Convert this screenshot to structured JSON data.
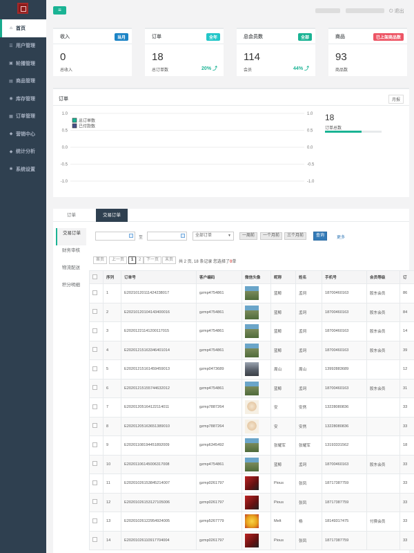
{
  "sidebar": {
    "items": [
      {
        "label": "首页",
        "icon": "home-icon",
        "glyph": "⌂",
        "active": true
      },
      {
        "label": "用户管理",
        "icon": "users-icon",
        "glyph": "☰"
      },
      {
        "label": "轮播管理",
        "icon": "image-icon",
        "glyph": "▣"
      },
      {
        "label": "商品管理",
        "icon": "box-icon",
        "glyph": "▤"
      },
      {
        "label": "库存管理",
        "icon": "stock-icon",
        "glyph": "◉"
      },
      {
        "label": "订单管理",
        "icon": "calendar-icon",
        "glyph": "▦"
      },
      {
        "label": "营销中心",
        "icon": "tag-icon",
        "glyph": "◆"
      },
      {
        "label": "统计分析",
        "icon": "tags-icon",
        "glyph": "◆"
      },
      {
        "label": "系统设置",
        "icon": "gears-icon",
        "glyph": "✱"
      }
    ]
  },
  "header": {
    "menu_glyph": "≡",
    "logout": "⏻ 退出"
  },
  "stats": [
    {
      "title": "收入",
      "badge": "当月",
      "badge_color": "#1c84c6",
      "value": "0",
      "label": "总收入",
      "pct": ""
    },
    {
      "title": "订单",
      "badge": "全年",
      "badge_color": "#23c6c8",
      "value": "18",
      "label": "总订单数",
      "pct": "20% ⤴"
    },
    {
      "title": "总会员数",
      "badge": "全部",
      "badge_color": "#1ab394",
      "value": "114",
      "label": "会员",
      "pct": "44% ⤴"
    },
    {
      "title": "商品",
      "badge": "已上架商品数",
      "badge_color": "#ed5565",
      "value": "93",
      "label": "商品数",
      "pct": ""
    }
  ],
  "chart_panel": {
    "title": "订单",
    "monthly_btn": "月报",
    "summary_value": "18",
    "summary_label": "订单总数",
    "summary_progress": 0.65
  },
  "chart_data": {
    "type": "line",
    "title": "",
    "xlabel": "",
    "ylabel": "",
    "ylim": [
      -1.0,
      1.0
    ],
    "yticks": [
      "1.0",
      "0.5",
      "0.0",
      "-0.5",
      "-1.0"
    ],
    "grid": true,
    "legend": "top-left",
    "series": [
      {
        "name": "总订单数",
        "color": "#1ab394",
        "values": []
      },
      {
        "name": "已付款数",
        "color": "#464f88",
        "values": []
      }
    ]
  },
  "orders": {
    "tabs": [
      "订单",
      "交易订单"
    ],
    "subnav": [
      "交易订单",
      "财务审核",
      "物流配送",
      "积分明细"
    ],
    "filter": {
      "sep": "至",
      "select_value": "全部订单",
      "range_buttons": [
        "一周前",
        "一个月前",
        "三个月前"
      ],
      "search": "查询",
      "more": "更多"
    },
    "pagination": {
      "first": "首页",
      "prev": "上一页",
      "pages": [
        "1",
        "2"
      ],
      "next": "下一页",
      "last": "末页",
      "info": "共 2 页, 18 条记录",
      "selected_prefix": "您选择了",
      "selected_count": "0",
      "selected_suffix": "单"
    },
    "columns": [
      "",
      "序列",
      "订单号",
      "客户编码",
      "微信头像",
      "昵称",
      "姓名",
      "手机号",
      "会员等级",
      "订"
    ],
    "rows": [
      {
        "n": "1",
        "order": "E20210120111424238017",
        "cust": "gzmp4754861",
        "avatar": "av-landscape",
        "nick": "蓝鲸",
        "name": "孟珂",
        "phone": "18700460163",
        "level": "股东会员",
        "extra": "86"
      },
      {
        "n": "2",
        "order": "E20210120104143400016",
        "cust": "gzmp4754861",
        "avatar": "av-landscape",
        "nick": "蓝鲸",
        "name": "孟珂",
        "phone": "18700460163",
        "level": "股东会员",
        "extra": "84"
      },
      {
        "n": "3",
        "order": "E20201221141200117015",
        "cust": "gzmp4754861",
        "avatar": "av-landscape",
        "nick": "蓝鲸",
        "name": "孟珂",
        "phone": "18700460163",
        "level": "股东会员",
        "extra": "14"
      },
      {
        "n": "4",
        "order": "E20201215163346401014",
        "cust": "gzmp4754861",
        "avatar": "av-landscape",
        "nick": "蓝鲸",
        "name": "孟珂",
        "phone": "18700460163",
        "level": "股东会员",
        "extra": "39"
      },
      {
        "n": "5",
        "order": "E20201215161459459013",
        "cust": "gzmp0473689",
        "avatar": "av-street",
        "nick": "周山",
        "name": "周山",
        "phone": "13992883689",
        "level": "",
        "extra": "12"
      },
      {
        "n": "6",
        "order": "E20201215155744632012",
        "cust": "gzmp4754861",
        "avatar": "av-landscape",
        "nick": "蓝鲸",
        "name": "孟珂",
        "phone": "18700460163",
        "level": "股东会员",
        "extra": "31"
      },
      {
        "n": "7",
        "order": "E20201205164122114011",
        "cust": "gzmp7887264",
        "avatar": "av-face",
        "nick": "安",
        "name": "安然",
        "phone": "13228080836",
        "level": "",
        "extra": "33"
      },
      {
        "n": "8",
        "order": "E20201205163651389010",
        "cust": "gzmp7887264",
        "avatar": "av-face",
        "nick": "安",
        "name": "安然",
        "phone": "13228080836",
        "level": "",
        "extra": "33"
      },
      {
        "n": "9",
        "order": "E20201108194451892009",
        "cust": "gzmp6345492",
        "avatar": "av-landscape",
        "nick": "张耀军",
        "name": "张耀军",
        "phone": "13193331562",
        "level": "",
        "extra": "18"
      },
      {
        "n": "10",
        "order": "E20201106145006317008",
        "cust": "gzmp4754861",
        "avatar": "av-landscape",
        "nick": "蓝鲸",
        "name": "孟珂",
        "phone": "18700460163",
        "level": "股东会员",
        "extra": "33"
      },
      {
        "n": "11",
        "order": "E20201026153845214007",
        "cust": "gzmp0261797",
        "avatar": "av-red",
        "nick": "Pious",
        "name": "张凤",
        "phone": "18717387759",
        "level": "",
        "extra": "33"
      },
      {
        "n": "12",
        "order": "E20201026153127105006",
        "cust": "gzmp0261797",
        "avatar": "av-red",
        "nick": "Pious",
        "name": "张凤",
        "phone": "18717387759",
        "level": "",
        "extra": "33"
      },
      {
        "n": "13",
        "order": "E20201026122954924005",
        "cust": "gzmp5267779",
        "avatar": "av-yellow",
        "nick": "Melt",
        "name": "杨",
        "phone": "18149317475",
        "level": "付费会员",
        "extra": "33"
      },
      {
        "n": "14",
        "order": "E20201026110917704004",
        "cust": "gzmp0261797",
        "avatar": "av-red",
        "nick": "Pious",
        "name": "张凤",
        "phone": "18717387759",
        "level": "",
        "extra": "33"
      }
    ]
  }
}
